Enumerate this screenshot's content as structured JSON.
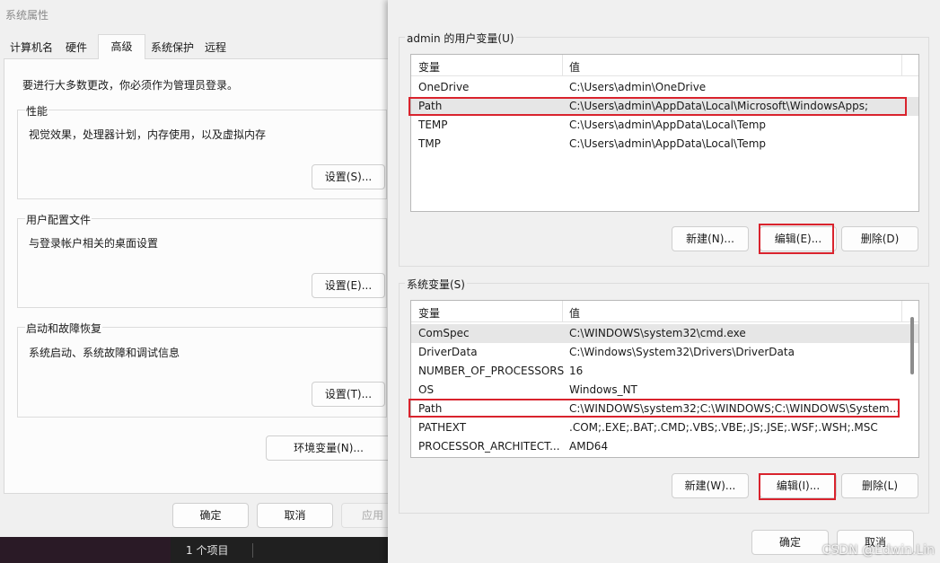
{
  "system_properties": {
    "title": "系统属性",
    "tabs": [
      "计算机名",
      "硬件",
      "高级",
      "系统保护",
      "远程"
    ],
    "active_tab": "高级",
    "admin_note": "要进行大多数更改，你必须作为管理员登录。",
    "performance": {
      "label": "性能",
      "description": "视觉效果，处理器计划，内存使用，以及虚拟内存",
      "button": "设置(S)..."
    },
    "user_profiles": {
      "label": "用户配置文件",
      "description": "与登录帐户相关的桌面设置",
      "button": "设置(E)..."
    },
    "startup_recovery": {
      "label": "启动和故障恢复",
      "description": "系统启动、系统故障和调试信息",
      "button": "设置(T)..."
    },
    "env_vars_button": "环境变量(N)...",
    "ok_button": "确定",
    "cancel_button": "取消",
    "apply_button": "应用",
    "taskbar_count": "1 个项目"
  },
  "env_vars": {
    "user_section_label": "admin 的用户变量(U)",
    "system_section_label": "系统变量(S)",
    "col_variable": "变量",
    "col_value": "值",
    "user_vars": [
      {
        "name": "OneDrive",
        "value": "C:\\Users\\admin\\OneDrive"
      },
      {
        "name": "Path",
        "value": "C:\\Users\\admin\\AppData\\Local\\Microsoft\\WindowsApps;"
      },
      {
        "name": "TEMP",
        "value": "C:\\Users\\admin\\AppData\\Local\\Temp"
      },
      {
        "name": "TMP",
        "value": "C:\\Users\\admin\\AppData\\Local\\Temp"
      }
    ],
    "system_vars": [
      {
        "name": "ComSpec",
        "value": "C:\\WINDOWS\\system32\\cmd.exe"
      },
      {
        "name": "DriverData",
        "value": "C:\\Windows\\System32\\Drivers\\DriverData"
      },
      {
        "name": "NUMBER_OF_PROCESSORS",
        "value": "16"
      },
      {
        "name": "OS",
        "value": "Windows_NT"
      },
      {
        "name": "Path",
        "value": "C:\\WINDOWS\\system32;C:\\WINDOWS;C:\\WINDOWS\\System..."
      },
      {
        "name": "PATHEXT",
        "value": ".COM;.EXE;.BAT;.CMD;.VBS;.VBE;.JS;.JSE;.WSF;.WSH;.MSC"
      },
      {
        "name": "PROCESSOR_ARCHITECT...",
        "value": "AMD64"
      }
    ],
    "user_buttons": {
      "new": "新建(N)...",
      "edit": "编辑(E)...",
      "delete": "删除(D)"
    },
    "system_buttons": {
      "new": "新建(W)...",
      "edit": "编辑(I)...",
      "delete": "删除(L)"
    },
    "ok_button": "确定",
    "cancel_button": "取消"
  },
  "watermark": "CSDN @Edwin.Lin",
  "colors": {
    "highlight_box": "#d9232d",
    "selected_row": "#e6e6e6",
    "dialog_bg": "#f0f0f0"
  }
}
